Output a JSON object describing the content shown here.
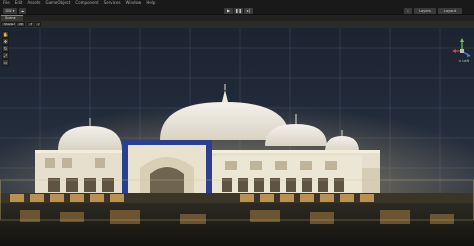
{
  "menu": {
    "items": [
      "File",
      "Edit",
      "Assets",
      "GameObject",
      "Component",
      "Services",
      "Window",
      "Help"
    ]
  },
  "toolbar": {
    "account_label": "DW ▾",
    "cloud_icon": "cloud-icon",
    "layers_label": "Layers",
    "layout_label": "Layout"
  },
  "scene_tab": {
    "label": "Scene"
  },
  "scene_toolbar": {
    "shading_mode": "Shaded",
    "view_mode": "2D"
  },
  "gizmo": {
    "view_label": "< Left"
  },
  "colors": {
    "accent": "#4a8fd8",
    "panel": "#191919",
    "sky_top": "#1c2331",
    "building": "#e8e2d2",
    "tile_blue": "#2b3f8f"
  }
}
